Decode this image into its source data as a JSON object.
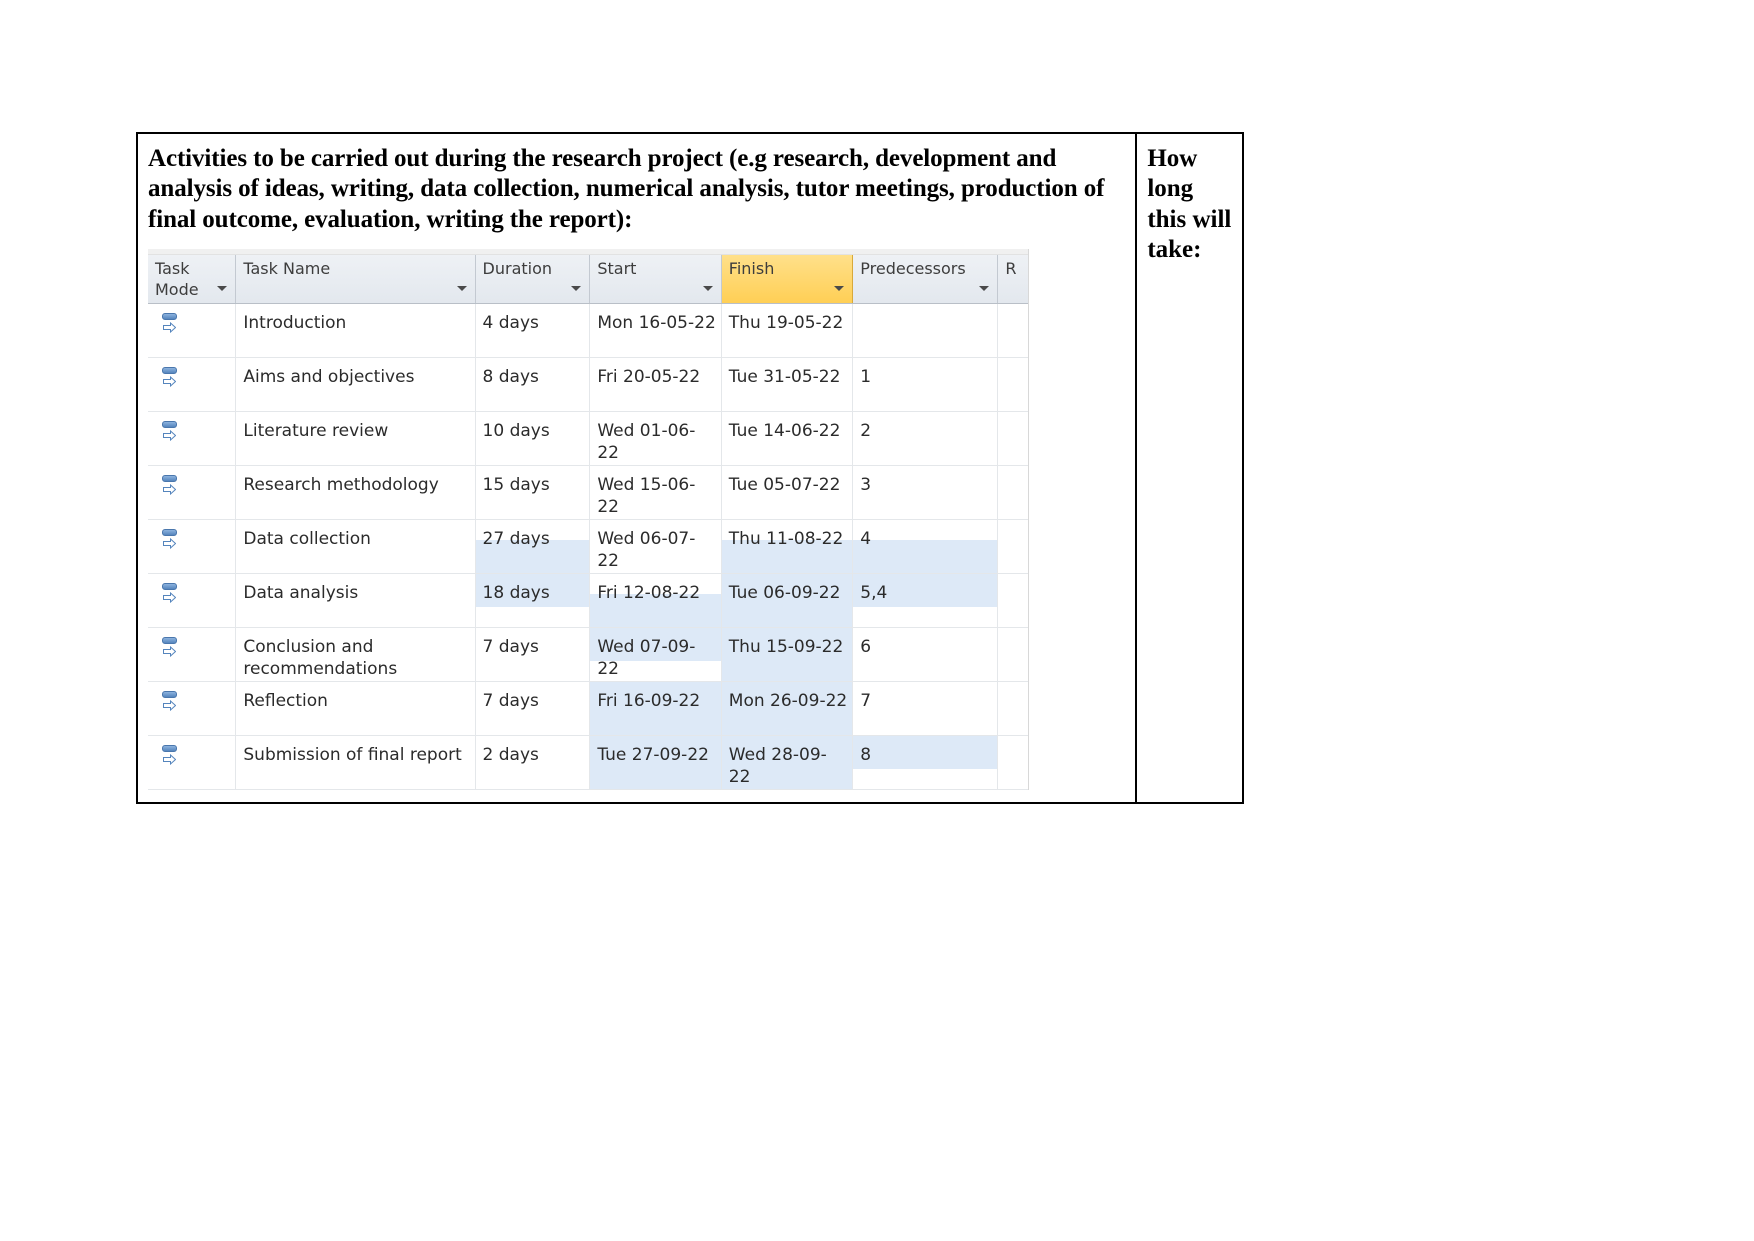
{
  "document": {
    "prompt_heading": "Activities to be carried out during the research project (e.g research, development and analysis of ideas, writing, data collection, numerical analysis, tutor meetings, production of final outcome, evaluation, writing the report):",
    "side_heading": "How long this will take:"
  },
  "project_grid": {
    "columns": [
      {
        "key": "mode",
        "label": "Task\nMode",
        "selected": false
      },
      {
        "key": "name",
        "label": "Task Name",
        "selected": false
      },
      {
        "key": "duration",
        "label": "Duration",
        "selected": false
      },
      {
        "key": "start",
        "label": "Start",
        "selected": false
      },
      {
        "key": "finish",
        "label": "Finish",
        "selected": true
      },
      {
        "key": "predecessors",
        "label": "Predecessors",
        "selected": false
      },
      {
        "key": "extra",
        "label": "R",
        "selected": false
      }
    ],
    "selected_column_color": "#ffcf55",
    "selection_fill_color": "#dde9f7",
    "header_fill_color": "#e3e8ee",
    "task_mode_icon": "auto-schedule-icon",
    "rows": [
      {
        "mode": "auto-schedule-icon",
        "name": "Introduction",
        "duration": "4 days",
        "start": "Mon 16-05-22",
        "finish": "Thu 19-05-22",
        "predecessors": ""
      },
      {
        "mode": "auto-schedule-icon",
        "name": "Aims and objectives",
        "duration": "8 days",
        "start": "Fri 20-05-22",
        "finish": "Tue 31-05-22",
        "predecessors": "1"
      },
      {
        "mode": "auto-schedule-icon",
        "name": "Literature review",
        "duration": "10 days",
        "start": "Wed 01-06-22",
        "finish": "Tue 14-06-22",
        "predecessors": "2"
      },
      {
        "mode": "auto-schedule-icon",
        "name": "Research methodology",
        "duration": "15 days",
        "start": "Wed 15-06-22",
        "finish": "Tue 05-07-22",
        "predecessors": "3"
      },
      {
        "mode": "auto-schedule-icon",
        "name": "Data collection",
        "duration": "27 days",
        "start": "Wed 06-07-22",
        "finish": "Thu 11-08-22",
        "predecessors": "4"
      },
      {
        "mode": "auto-schedule-icon",
        "name": "Data analysis",
        "duration": "18 days",
        "start": "Fri 12-08-22",
        "finish": "Tue 06-09-22",
        "predecessors": "5,4"
      },
      {
        "mode": "auto-schedule-icon",
        "name": "Conclusion and recommendations",
        "duration": "7 days",
        "start": "Wed 07-09-22",
        "finish": "Thu 15-09-22",
        "predecessors": "6"
      },
      {
        "mode": "auto-schedule-icon",
        "name": "Reflection",
        "duration": "7 days",
        "start": "Fri 16-09-22",
        "finish": "Mon 26-09-22",
        "predecessors": "7"
      },
      {
        "mode": "auto-schedule-icon",
        "name": "Submission of final report",
        "duration": "2 days",
        "start": "Tue 27-09-22",
        "finish": "Wed 28-09-22",
        "predecessors": "8"
      }
    ]
  }
}
